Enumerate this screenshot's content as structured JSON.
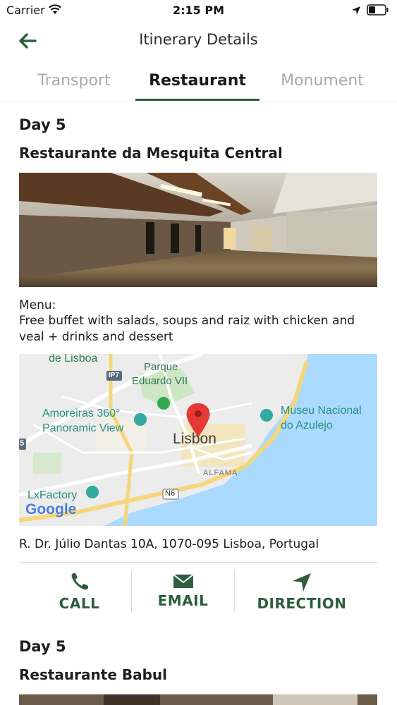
{
  "status_bar": {
    "carrier": "Carrier",
    "time": "2:15 PM"
  },
  "header": {
    "title": "Itinerary Details",
    "back_icon": "arrow-left-icon"
  },
  "tabs": [
    {
      "label": "Transport",
      "active": false
    },
    {
      "label": "Restaurant",
      "active": true
    },
    {
      "label": "Monument",
      "active": false
    }
  ],
  "items": [
    {
      "day": "Day 5",
      "name": "Restaurante da Mesquita Central",
      "menu_label": "Menu:",
      "menu_text": "Free buffet with salads, soups and raiz with chicken and veal + drinks and dessert",
      "map": {
        "labels": {
          "de_lisboa": "de Lisboa",
          "parque": "Parque",
          "eduardo": "Eduardo VII",
          "amoreiras": "Amoreiras 360°",
          "panoramic": "Panoramic View",
          "museu": "Museu Nacional",
          "azulejo": "do Azulejo",
          "lisbon": "Lisbon",
          "alfama": "ALFAMA",
          "lxfactory": "LxFactory",
          "n6": "N6",
          "ip7": "IP7",
          "five": "5",
          "google": "Google"
        }
      },
      "address": "R. Dr. Júlio Dantas 10A, 1070-095 Lisboa, Portugal",
      "actions": {
        "call": "CALL",
        "email": "EMAIL",
        "direction": "DIRECTION"
      }
    },
    {
      "day": "Day 5",
      "name": "Restaurante Babul"
    }
  ],
  "colors": {
    "accent": "#2d5e3e",
    "map_water": "#aadaff",
    "map_land": "#ececec",
    "pin": "#e53935"
  }
}
